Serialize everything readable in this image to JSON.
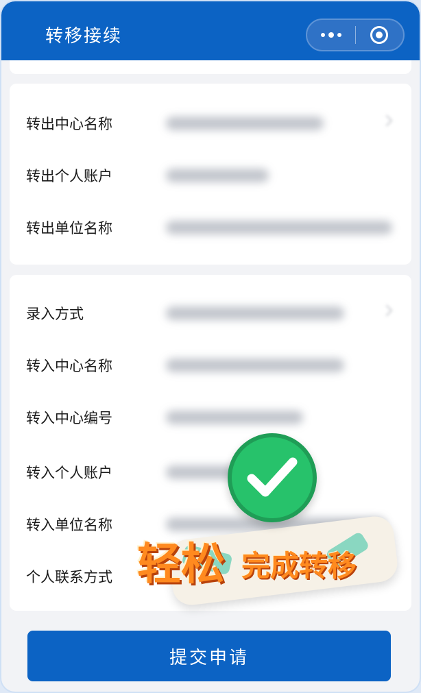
{
  "header": {
    "title": "转移接续",
    "more_icon": "more-dots-icon",
    "close_icon": "target-circle-icon"
  },
  "transfer_out": {
    "rows": [
      {
        "label": "转出中心名称"
      },
      {
        "label": "转出个人账户"
      },
      {
        "label": "转出单位名称"
      }
    ]
  },
  "transfer_in": {
    "rows": [
      {
        "label": "录入方式"
      },
      {
        "label": "转入中心名称"
      },
      {
        "label": "转入中心编号"
      },
      {
        "label": "转入个人账户"
      },
      {
        "label": "转入单位名称"
      },
      {
        "label": "个人联系方式"
      }
    ]
  },
  "submit_label": "提交申请",
  "overlay": {
    "text_large": "轻松",
    "text_small": "完成转移",
    "icon": "check-icon"
  },
  "colors": {
    "brand": "#0c63c4",
    "background": "#f2f3f6",
    "overlay_green": "#27c26b",
    "overlay_orange": "#ff8a1f"
  }
}
